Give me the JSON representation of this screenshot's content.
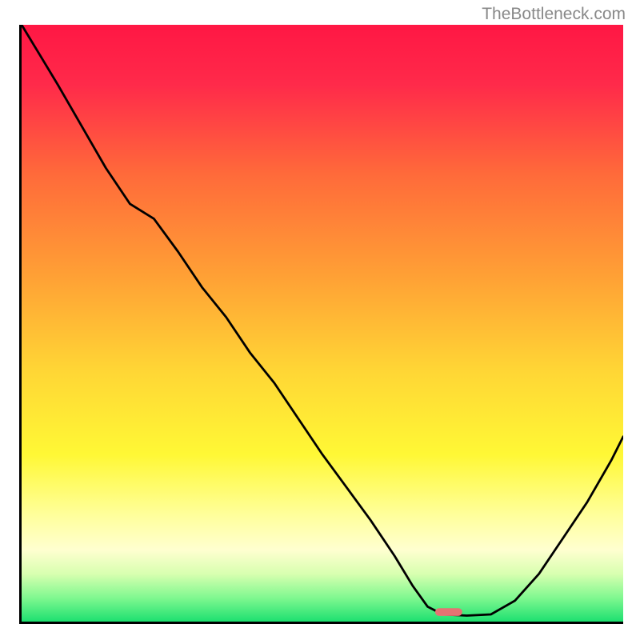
{
  "watermark": "TheBottleneck.com",
  "chart_data": {
    "type": "line",
    "title": "",
    "xlabel": "",
    "ylabel": "",
    "xlim": [
      0,
      100
    ],
    "ylim": [
      0,
      100
    ],
    "gradient": {
      "stops": [
        {
          "offset": 0,
          "color": "#ff1744"
        },
        {
          "offset": 10,
          "color": "#ff2a4a"
        },
        {
          "offset": 25,
          "color": "#ff6a3a"
        },
        {
          "offset": 42,
          "color": "#ffa035"
        },
        {
          "offset": 58,
          "color": "#ffd635"
        },
        {
          "offset": 72,
          "color": "#fff835"
        },
        {
          "offset": 82,
          "color": "#ffff9a"
        },
        {
          "offset": 88,
          "color": "#ffffd0"
        },
        {
          "offset": 92,
          "color": "#d8ffb0"
        },
        {
          "offset": 96,
          "color": "#80f890"
        },
        {
          "offset": 100,
          "color": "#1de070"
        }
      ]
    },
    "curve": {
      "x": [
        0,
        3,
        6,
        10,
        14,
        18,
        22,
        26,
        30,
        34,
        38,
        42,
        46,
        50,
        54,
        58,
        62,
        65,
        67.5,
        70,
        74,
        78,
        82,
        86,
        90,
        94,
        98,
        100
      ],
      "y": [
        100,
        95,
        90,
        83,
        76,
        70,
        67.5,
        62,
        56,
        51,
        45,
        40,
        34,
        28,
        22.5,
        17,
        11,
        6,
        2.5,
        1.2,
        1.0,
        1.2,
        3.5,
        8,
        14,
        20,
        27,
        31
      ]
    },
    "marker": {
      "x": 71.0,
      "y": 1.6,
      "width": 4.5,
      "height": 1.3,
      "color": "#e57373"
    }
  }
}
